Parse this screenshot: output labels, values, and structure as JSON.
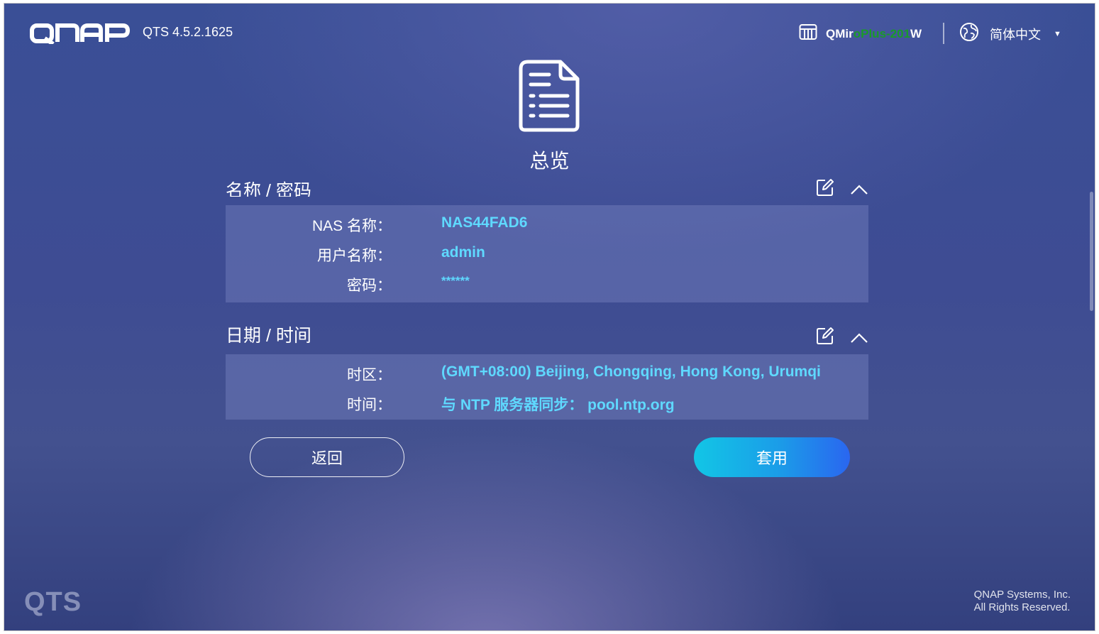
{
  "header": {
    "logo_text": "QNAP",
    "version": "QTS 4.5.2.1625",
    "device": {
      "name_prefix": "QMir",
      "name_overlay": "oPlus-201",
      "name_suffix": "W",
      "icon": "device-icon"
    },
    "language": {
      "label": "简体中文",
      "icon": "globe-icon"
    }
  },
  "page": {
    "title": "总览",
    "icon": "document-list-icon"
  },
  "sections": {
    "name_password": {
      "title": "名称 / 密码",
      "rows": [
        {
          "label": "NAS 名称：",
          "value": "NAS44FAD6"
        },
        {
          "label": "用户名称：",
          "value": "admin"
        },
        {
          "label": "密码：",
          "value": "******"
        }
      ]
    },
    "datetime": {
      "title": "日期 / 时间",
      "rows": [
        {
          "label": "时区：",
          "value": "(GMT+08:00) Beijing, Chongqing, Hong Kong, Urumqi"
        },
        {
          "label": "时间：",
          "value": "与 NTP 服务器同步： pool.ntp.org"
        }
      ]
    }
  },
  "buttons": {
    "back": "返回",
    "apply": "套用"
  },
  "footer": {
    "brand": "QTS",
    "company": "QNAP Systems, Inc.",
    "rights": "All Rights Reserved."
  },
  "colors": {
    "accent_value": "#5fd9ff",
    "apply_gradient_start": "#12c6e6",
    "apply_gradient_end": "#2a66f0",
    "background": "#3e4c93"
  }
}
